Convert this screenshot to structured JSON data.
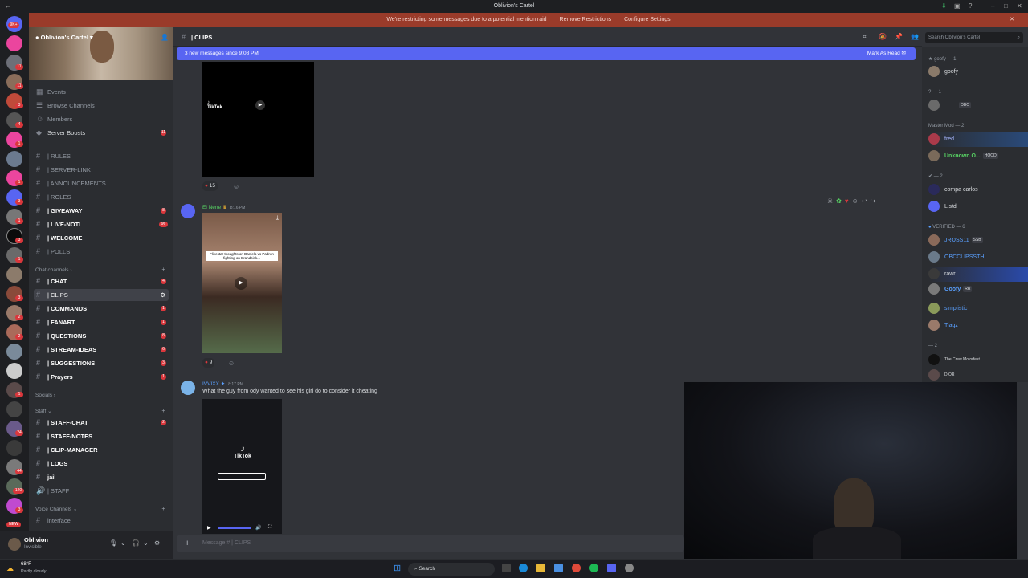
{
  "window": {
    "title": "Oblivion's Cartel"
  },
  "notice": {
    "text": "We're restricting some messages due to a potential mention raid",
    "remove": "Remove Restrictions",
    "configure": "Configure Settings"
  },
  "rail": {
    "top_badge": "9K+",
    "badges": [
      "11",
      "11",
      "3",
      "4",
      "1",
      "1",
      "3",
      "1",
      "3",
      "1",
      "3",
      "2",
      "2",
      "1",
      "24",
      "44",
      "120",
      "3"
    ],
    "new_label": "NEW"
  },
  "server": {
    "name": "Oblivion's Cartel"
  },
  "sidebar": {
    "top_items": [
      {
        "label": "Events"
      },
      {
        "label": "Browse Channels"
      },
      {
        "label": "Members"
      },
      {
        "label": "Server Boosts",
        "count": "11"
      }
    ],
    "channels_a": [
      {
        "label": "| RULES"
      },
      {
        "label": "| SERVER-LINK"
      },
      {
        "label": "| ANNOUNCEMENTS"
      },
      {
        "label": "| ROLES"
      },
      {
        "label": "| GIVEAWAY",
        "count": "8"
      },
      {
        "label": "| LIVE-NOTI",
        "count": "96"
      },
      {
        "label": "| WELCOME"
      },
      {
        "label": "| POLLS"
      }
    ],
    "chat_category": "Chat channels",
    "channels_b": [
      {
        "label": "| CHAT",
        "count": "4"
      },
      {
        "label": "| CLIPS"
      },
      {
        "label": "| COMMANDS",
        "count": "1"
      },
      {
        "label": "| FANART",
        "count": "1"
      },
      {
        "label": "| QUESTIONS",
        "count": "8"
      },
      {
        "label": "| STREAM-IDEAS",
        "count": "6"
      },
      {
        "label": "| SUGGESTIONS",
        "count": "3"
      },
      {
        "label": "| Prayers",
        "count": "1"
      }
    ],
    "socials_category": "Socials",
    "staff_category": "Staff",
    "channels_c": [
      {
        "label": "| STAFF-CHAT",
        "count": "2"
      },
      {
        "label": "| STAFF-NOTES"
      },
      {
        "label": "| CLIP-MANAGER"
      },
      {
        "label": "| LOGS"
      },
      {
        "label": "jail"
      },
      {
        "label": "| STAFF"
      }
    ],
    "voice_category": "Voice Channels",
    "voice": [
      {
        "label": "interface"
      }
    ]
  },
  "user": {
    "name": "Oblivion",
    "status": "Invisible"
  },
  "header": {
    "channel": "| CLIPS",
    "search_placeholder": "Search Oblivion's Cartel"
  },
  "new_messages": {
    "text": "3 new messages since 9:08 PM",
    "mark": "Mark As Read"
  },
  "messages": [
    {
      "reaction_count": "15"
    },
    {
      "author": "El Nene",
      "time": "8:16 PM",
      "thumb_caption": "Flivestar thoughts on Daniela vs Padron fighting on Brandbisk...",
      "reaction_count": "9"
    },
    {
      "author": "IVVIXX",
      "time": "8:17 PM",
      "text": "What the guy from ody wanted to see his girl do to consider it cheating",
      "video_label": "TikTok"
    }
  ],
  "tiktok_small": "TikTok",
  "composer": {
    "placeholder": "Message # | CLIPS"
  },
  "members": {
    "groups": [
      {
        "title": "goofy — 1",
        "items": [
          {
            "name": "goofy",
            "color": "#dbdee1"
          }
        ]
      },
      {
        "title": "? — 1",
        "items": [
          {
            "name": "",
            "color": "#dbdee1",
            "tag": "OBC"
          }
        ]
      },
      {
        "title": "Master Mod — 2",
        "items": [
          {
            "name": "fred",
            "color": "#a5b4fc"
          },
          {
            "name": "Unknown O...",
            "color": "#57d163",
            "tag": "HOOD"
          }
        ]
      },
      {
        "title": "— 2",
        "items": [
          {
            "name": "compa carlos",
            "color": "#dbdee1"
          },
          {
            "name": "Listd",
            "color": "#dbdee1"
          }
        ]
      },
      {
        "title": "VERIFIED — 6",
        "items": [
          {
            "name": "JROSS11",
            "color": "#5aa0ff",
            "tag": "SSB"
          },
          {
            "name": "OBCCLIPSSTH",
            "color": "#5aa0ff"
          },
          {
            "name": "rawr",
            "color": "#dbdee1"
          },
          {
            "name": "Goofy",
            "color": "#5aa0ff",
            "tag": "RR"
          },
          {
            "name": "simplistic",
            "color": "#5aa0ff"
          },
          {
            "name": "Tiagz",
            "color": "#5aa0ff"
          }
        ]
      },
      {
        "title": "— 2",
        "items": [
          {
            "name": "The Crew Motorfest",
            "color": "#dbdee1"
          },
          {
            "name": "DIOR",
            "color": "#dbdee1"
          }
        ]
      }
    ]
  },
  "taskbar": {
    "temp": "68°F",
    "weather": "Partly cloudy",
    "search": "Search"
  }
}
